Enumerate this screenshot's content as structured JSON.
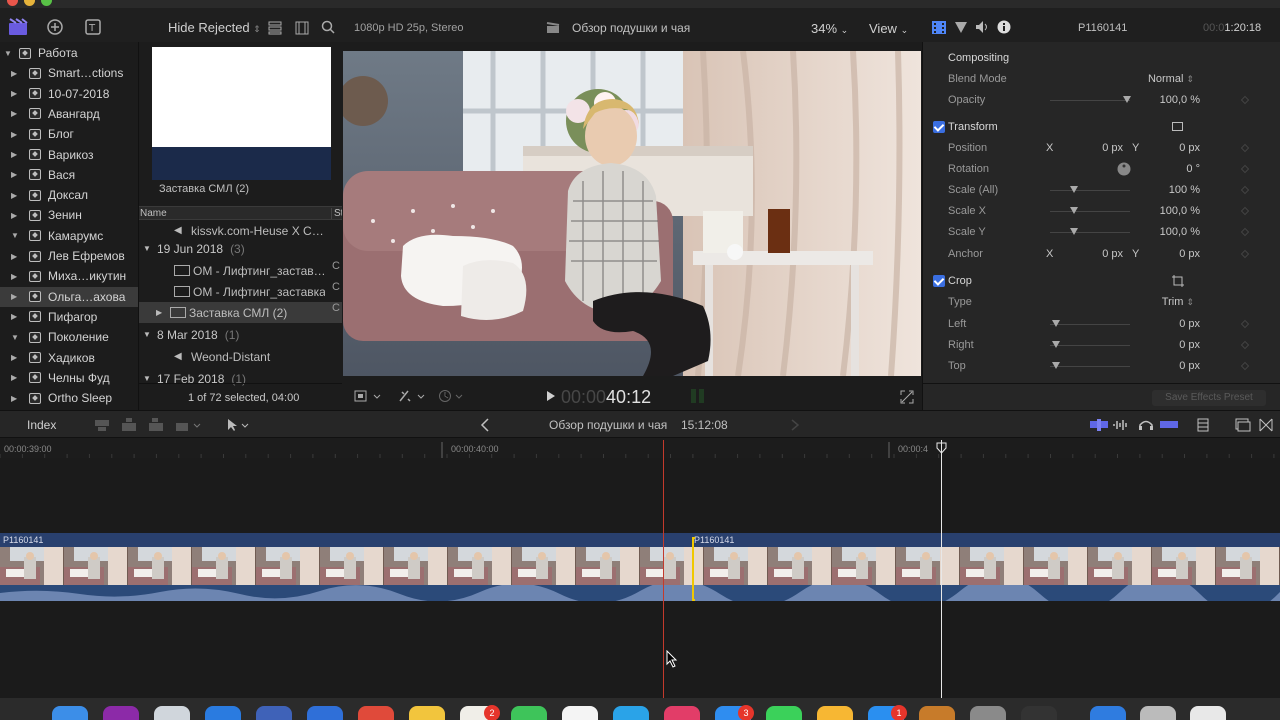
{
  "toolbar": {
    "filter_label": "Hide Rejected",
    "format_info": "1080p HD 25p, Stereo",
    "project_title": "Обзор подушки и чая",
    "zoom_level": "34%",
    "view_label": "View",
    "inspector_clip_name": "P1160141",
    "inspector_duration_faded": "00:0",
    "inspector_duration": "1:20:18"
  },
  "sidebar": {
    "items": [
      {
        "label": "Работа",
        "expanded": true,
        "root": true
      },
      {
        "label": "Smart…ctions"
      },
      {
        "label": "10-07-2018"
      },
      {
        "label": "Авангард"
      },
      {
        "label": "Блог"
      },
      {
        "label": "Варикоз"
      },
      {
        "label": "Вася"
      },
      {
        "label": "Доксал"
      },
      {
        "label": "Зенин"
      },
      {
        "label": "Камарумс",
        "expanded": true
      },
      {
        "label": "Лев Ефремов"
      },
      {
        "label": "Миха…икутин"
      },
      {
        "label": "Ольга…ахова",
        "selected": true
      },
      {
        "label": "Пифагор"
      },
      {
        "label": "Поколение",
        "expanded": true
      },
      {
        "label": "Хадиков"
      },
      {
        "label": "Челны Фуд"
      },
      {
        "label": "Ortho Sleep"
      }
    ]
  },
  "browser": {
    "thumbnail_caption": "Заставка СМЛ (2)",
    "column_name": "Name",
    "column_start_abbrev": "St",
    "rows": [
      {
        "type": "clip-audio",
        "label": "kissvk.com-Heuse X C…"
      },
      {
        "type": "group",
        "label": "19 Jun 2018",
        "count": "(3)"
      },
      {
        "type": "clip-video",
        "label": "ОМ - Лифтинг_застав…",
        "col2": "C"
      },
      {
        "type": "clip-video",
        "label": "ОМ - Лифтинг_заставка",
        "col2": "C"
      },
      {
        "type": "clip-video-sel",
        "label": "Заставка СМЛ (2)",
        "col2": "C"
      },
      {
        "type": "group",
        "label": "8 Mar 2018",
        "count": "(1)"
      },
      {
        "type": "clip-audio",
        "label": "Weond-Distant"
      },
      {
        "type": "group",
        "label": "17 Feb 2018",
        "count": "(1)"
      }
    ],
    "status": "1 of 72 selected, 04:00"
  },
  "viewer": {
    "timecode_faded": "00:00",
    "timecode": "40:12"
  },
  "inspector": {
    "compositing_header": "Compositing",
    "blend_mode_label": "Blend Mode",
    "blend_mode_value": "Normal",
    "opacity_label": "Opacity",
    "opacity_value": "100,0",
    "opacity_unit": "%",
    "transform_header": "Transform",
    "position_label": "Position",
    "position_x_label": "X",
    "position_x_value": "0",
    "position_y_label": "Y",
    "position_y_value": "0",
    "unit_px": "px",
    "rotation_label": "Rotation",
    "rotation_value": "0",
    "rotation_unit": "°",
    "scale_all_label": "Scale (All)",
    "scale_all_value": "100",
    "scale_all_unit": "%",
    "scale_x_label": "Scale X",
    "scale_x_value": "100,0",
    "scale_y_label": "Scale Y",
    "scale_y_value": "100,0",
    "anchor_label": "Anchor",
    "anchor_x_label": "X",
    "anchor_x_value": "0",
    "anchor_y_label": "Y",
    "anchor_y_value": "0",
    "crop_header": "Crop",
    "type_label": "Type",
    "type_value": "Trim",
    "left_label": "Left",
    "left_value": "0",
    "right_label": "Right",
    "right_value": "0",
    "top_label": "Top",
    "top_value": "0",
    "save_preset": "Save Effects Preset"
  },
  "timeline": {
    "index_label": "Index",
    "project_title": "Обзор подушки и чая",
    "project_duration": "15:12:08",
    "ruler_marks": [
      "00:00:39:00",
      "00:00:40:00",
      "00:00:4"
    ],
    "clip_name_1": "P1160141",
    "clip_name_2": "P1160141"
  },
  "dock": {
    "badges": [
      "2",
      "3",
      "1"
    ]
  },
  "colors": {
    "accent_blue": "#3a6ee0",
    "clip_blue": "#29406e",
    "playhead_red": "#d7412e",
    "skimmer_white": "#ffffff",
    "edit_point_yellow": "#f0c800"
  }
}
